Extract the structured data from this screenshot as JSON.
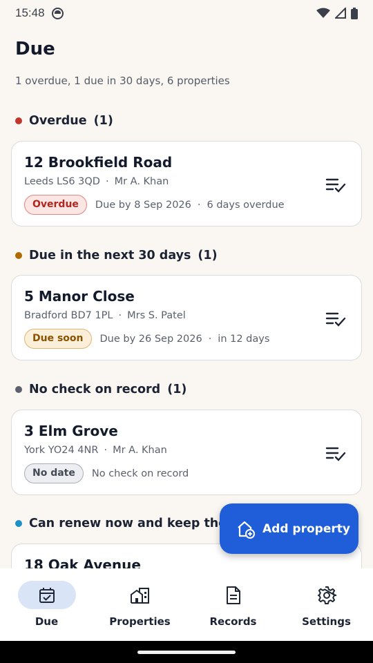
{
  "status": {
    "time": "15:48"
  },
  "header": {
    "title": "Due",
    "summary": "1 overdue, 1 due in 30 days, 6 properties"
  },
  "colors": {
    "overdue": "#c0362c",
    "due_soon": "#b06a00",
    "no_record": "#5c6170",
    "renew": "#1e90c8",
    "primary": "#1f5ed8"
  },
  "sections": [
    {
      "title": "Overdue",
      "count": "(1)"
    },
    {
      "title": "Due in the next 30 days",
      "count": "(1)"
    },
    {
      "title": "No check on record",
      "count": "(1)"
    },
    {
      "title": "Can renew now and keep the date",
      "count": ""
    }
  ],
  "cards": [
    {
      "name": "12 Brookfield Road",
      "location": "Leeds LS6 3QD",
      "tenant": "Mr A. Khan",
      "badge": "Overdue",
      "due": "Due by 8 Sep 2026",
      "delta": "6 days overdue"
    },
    {
      "name": "5 Manor Close",
      "location": "Bradford BD7 1PL",
      "tenant": "Mrs S. Patel",
      "badge": "Due soon",
      "due": "Due by 26 Sep 2026",
      "delta": "in 12 days"
    },
    {
      "name": "3 Elm Grove",
      "location": "York YO24 4NR",
      "tenant": "Mr A. Khan",
      "badge": "No date",
      "due": "No check on record"
    },
    {
      "name": "18 Oak Avenue"
    }
  ],
  "fab": {
    "label": "Add property",
    "icon": "add-home-icon"
  },
  "nav": [
    {
      "label": "Due",
      "icon": "calendar-check-icon",
      "active": true
    },
    {
      "label": "Properties",
      "icon": "buildings-icon"
    },
    {
      "label": "Records",
      "icon": "document-icon"
    },
    {
      "label": "Settings",
      "icon": "gear-icon"
    }
  ]
}
